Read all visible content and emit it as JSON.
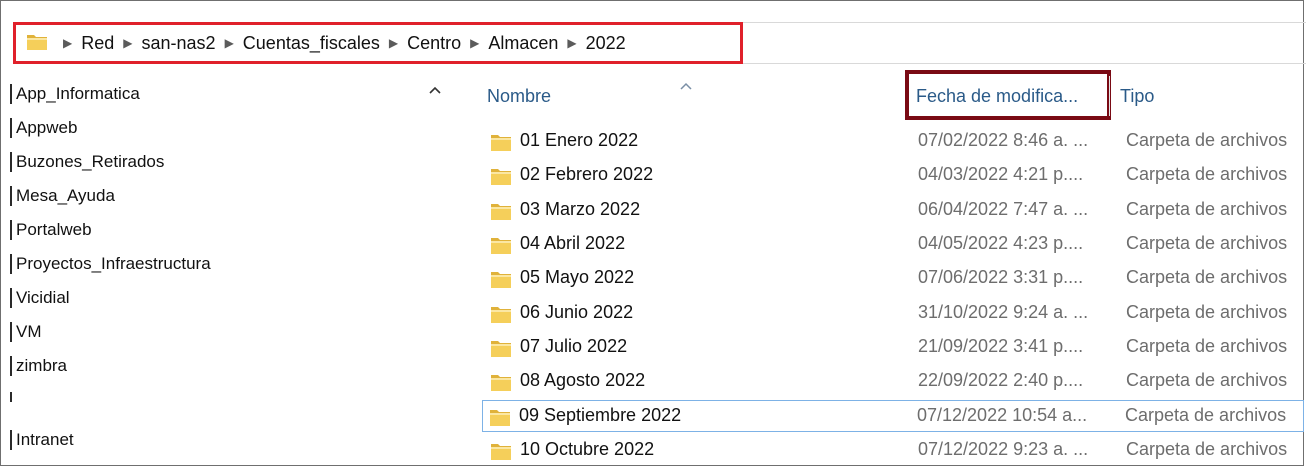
{
  "address_bar": {
    "crumbs": [
      "Red",
      "san-nas2",
      "Cuentas_fiscales",
      "Centro",
      "Almacen",
      "2022"
    ],
    "folder_icon": "folder-icon",
    "separator_icon": "chevron-right-icon"
  },
  "sidebar": {
    "items": [
      {
        "label": "App_Informatica"
      },
      {
        "label": "Appweb"
      },
      {
        "label": "Buzones_Retirados"
      },
      {
        "label": "Mesa_Ayuda"
      },
      {
        "label": "Portalweb"
      },
      {
        "label": "Proyectos_Infraestructura"
      },
      {
        "label": "Vicidial"
      },
      {
        "label": "VM"
      },
      {
        "label": "zimbra"
      },
      {
        "label": ""
      },
      {
        "label": "Intranet"
      }
    ],
    "scroll_up_icon": "caret-up-icon"
  },
  "columns": {
    "name": "Nombre",
    "date": "Fecha de modifica...",
    "type": "Tipo"
  },
  "files": [
    {
      "name": "01 Enero 2022",
      "date": "07/02/2022 8:46 a. ...",
      "type": "Carpeta de archivos"
    },
    {
      "name": "02 Febrero 2022",
      "date": "04/03/2022 4:21 p....",
      "type": "Carpeta de archivos"
    },
    {
      "name": "03 Marzo 2022",
      "date": "06/04/2022 7:47 a. ...",
      "type": "Carpeta de archivos"
    },
    {
      "name": "04 Abril 2022",
      "date": "04/05/2022 4:23 p....",
      "type": "Carpeta de archivos"
    },
    {
      "name": "05 Mayo 2022",
      "date": "07/06/2022 3:31 p....",
      "type": "Carpeta de archivos"
    },
    {
      "name": "06 Junio 2022",
      "date": "31/10/2022 9:24 a. ...",
      "type": "Carpeta de archivos"
    },
    {
      "name": "07 Julio 2022",
      "date": "21/09/2022 3:41 p....",
      "type": "Carpeta de archivos"
    },
    {
      "name": "08 Agosto 2022",
      "date": "22/09/2022 2:40 p....",
      "type": "Carpeta de archivos"
    },
    {
      "name": "09 Septiembre 2022",
      "date": "07/12/2022 10:54 a...",
      "type": "Carpeta de archivos",
      "selected": true
    },
    {
      "name": "10 Octubre 2022",
      "date": "07/12/2022 9:23 a. ...",
      "type": "Carpeta de archivos"
    }
  ],
  "colors": {
    "address_highlight": "#e0202a",
    "date_header_highlight": "#7a0a14",
    "header_text": "#2a5a88",
    "folder_yellow": "#f2c94c"
  }
}
